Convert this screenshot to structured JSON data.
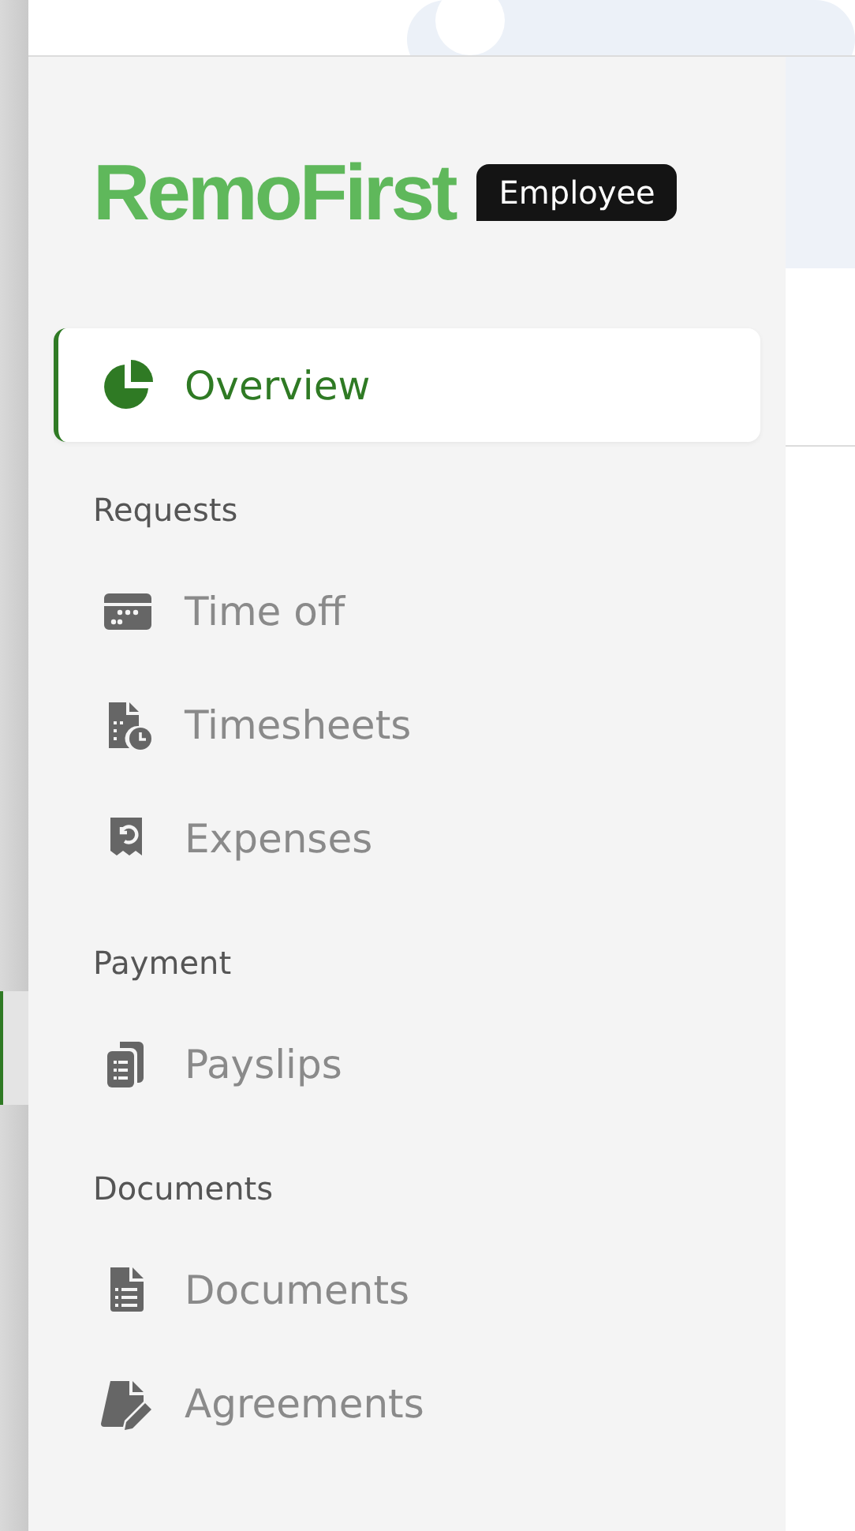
{
  "logo": {
    "text": "RemoFirst",
    "badge": "Employee"
  },
  "sections": [
    {
      "items": [
        {
          "label": "Overview",
          "selected": true
        }
      ]
    },
    {
      "label": "Requests",
      "items": [
        {
          "label": "Time off",
          "selected": false
        },
        {
          "label": "Timesheets",
          "selected": false
        },
        {
          "label": "Expenses",
          "selected": false
        }
      ]
    },
    {
      "label": "Payment",
      "items": [
        {
          "label": "Payslips",
          "selected": false
        }
      ]
    },
    {
      "label": "Documents",
      "items": [
        {
          "label": "Documents",
          "selected": false
        },
        {
          "label": "Agreements",
          "selected": false
        }
      ]
    }
  ]
}
